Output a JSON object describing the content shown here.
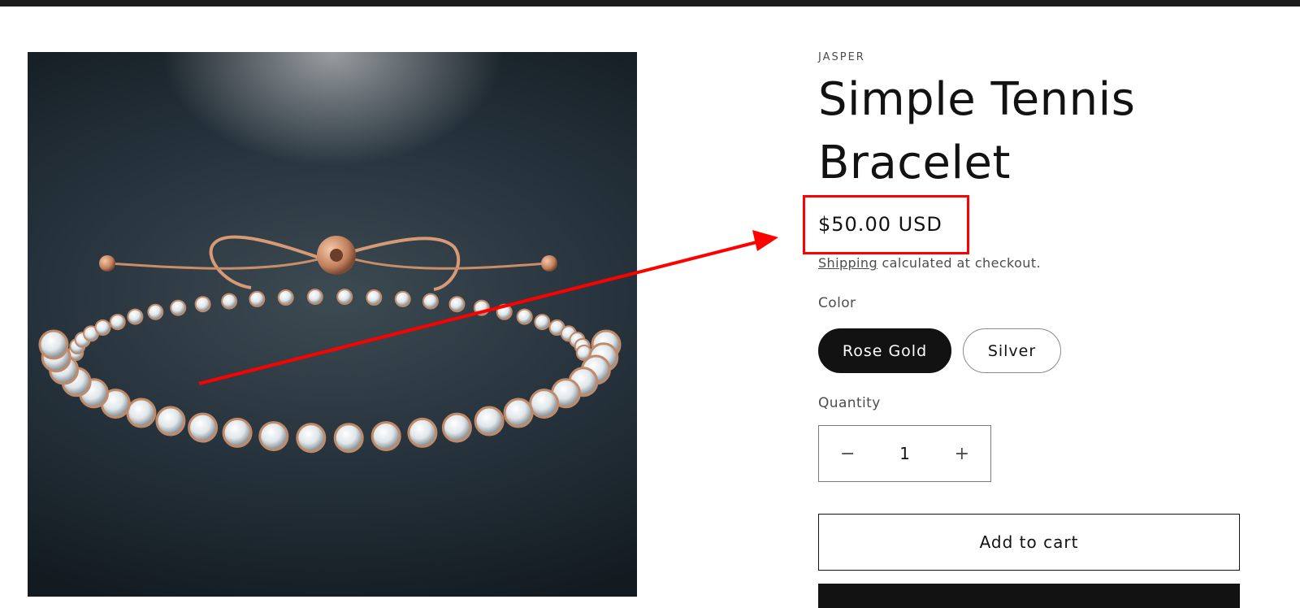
{
  "product": {
    "vendor": "JASPER",
    "title": "Simple Tennis Bracelet",
    "price": "$50.00 USD",
    "shipping_link": "Shipping",
    "shipping_suffix": " calculated at checkout.",
    "color_label": "Color",
    "colors": [
      "Rose Gold",
      "Silver"
    ],
    "selected_color": "Rose Gold",
    "quantity_label": "Quantity",
    "quantity": "1",
    "minus_symbol": "−",
    "plus_symbol": "+",
    "add_to_cart": "Add to cart"
  },
  "icons": {
    "decrease": "minus-icon",
    "increase": "plus-icon"
  },
  "colors": {
    "annotation": "#ff0000",
    "primary": "#121212",
    "background": "#ffffff"
  }
}
